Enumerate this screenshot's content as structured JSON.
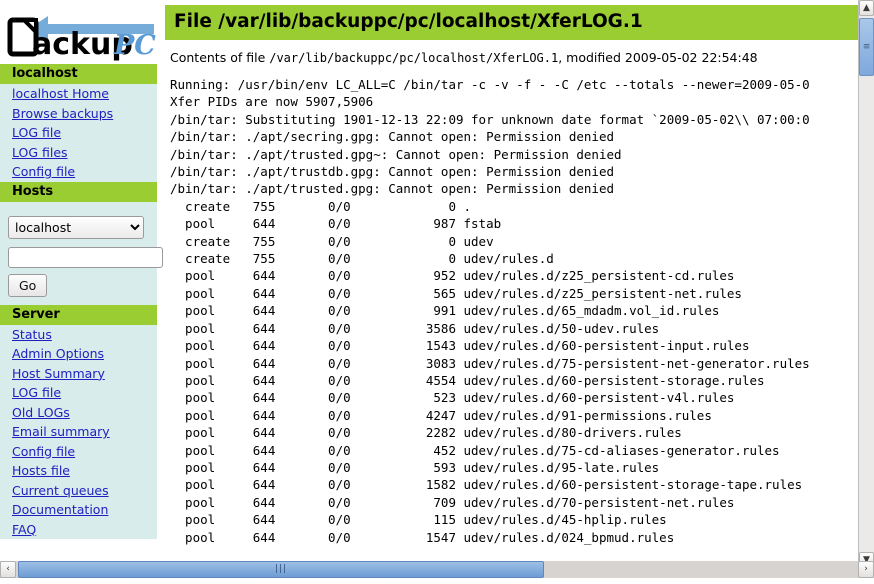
{
  "app": {
    "logo_primary": "ackup",
    "logo_secondary": "PC",
    "logo_icon": "document-arrow-logo"
  },
  "sidebar": {
    "host_section": {
      "heading": "localhost",
      "links": [
        {
          "label": "localhost Home",
          "name": "sidebar-link-localhost-home"
        },
        {
          "label": "Browse backups",
          "name": "sidebar-link-browse-backups"
        },
        {
          "label": "LOG file",
          "name": "sidebar-link-host-log-file"
        },
        {
          "label": "LOG files",
          "name": "sidebar-link-host-log-files"
        },
        {
          "label": "Config file",
          "name": "sidebar-link-host-config-file"
        }
      ]
    },
    "hosts_section": {
      "heading": "Hosts",
      "select_value": "localhost",
      "select_options": [
        "localhost"
      ],
      "search_value": "",
      "search_placeholder": "",
      "go_label": "Go"
    },
    "server_section": {
      "heading": "Server",
      "links": [
        {
          "label": "Status",
          "name": "sidebar-link-status"
        },
        {
          "label": "Admin Options",
          "name": "sidebar-link-admin-options"
        },
        {
          "label": "Host Summary",
          "name": "sidebar-link-host-summary"
        },
        {
          "label": "LOG file",
          "name": "sidebar-link-server-log-file"
        },
        {
          "label": "Old LOGs",
          "name": "sidebar-link-old-logs"
        },
        {
          "label": "Email summary",
          "name": "sidebar-link-email-summary"
        },
        {
          "label": "Config file",
          "name": "sidebar-link-server-config-file"
        },
        {
          "label": "Hosts file",
          "name": "sidebar-link-hosts-file"
        },
        {
          "label": "Current queues",
          "name": "sidebar-link-current-queues"
        },
        {
          "label": "Documentation",
          "name": "sidebar-link-documentation"
        },
        {
          "label": "FAQ",
          "name": "sidebar-link-faq"
        }
      ]
    }
  },
  "main": {
    "title": "File /var/lib/backuppc/pc/localhost/XferLOG.1",
    "subtitle_prefix": "Contents of file ",
    "subtitle_path": "/var/lib/backuppc/pc/localhost/XferLOG.1",
    "subtitle_suffix": ", modified 2009-05-02 22:54:48",
    "log_text": "Running: /usr/bin/env LC_ALL=C /bin/tar -c -v -f - -C /etc --totals --newer=2009-05-0\nXfer PIDs are now 5907,5906\n/bin/tar: Substituting 1901-12-13 22:09 for unknown date format `2009-05-02\\\\ 07:00:0\n/bin/tar: ./apt/secring.gpg: Cannot open: Permission denied\n/bin/tar: ./apt/trusted.gpg~: Cannot open: Permission denied\n/bin/tar: ./apt/trustdb.gpg: Cannot open: Permission denied\n/bin/tar: ./apt/trusted.gpg: Cannot open: Permission denied\n  create   755       0/0             0 .\n  pool     644       0/0           987 fstab\n  create   755       0/0             0 udev\n  create   755       0/0             0 udev/rules.d\n  pool     644       0/0           952 udev/rules.d/z25_persistent-cd.rules\n  pool     644       0/0           565 udev/rules.d/z25_persistent-net.rules\n  pool     644       0/0           991 udev/rules.d/65_mdadm.vol_id.rules\n  pool     644       0/0          3586 udev/rules.d/50-udev.rules\n  pool     644       0/0          1543 udev/rules.d/60-persistent-input.rules\n  pool     644       0/0          3083 udev/rules.d/75-persistent-net-generator.rules\n  pool     644       0/0          4554 udev/rules.d/60-persistent-storage.rules\n  pool     644       0/0           523 udev/rules.d/60-persistent-v4l.rules\n  pool     644       0/0          4247 udev/rules.d/91-permissions.rules\n  pool     644       0/0          2282 udev/rules.d/80-drivers.rules\n  pool     644       0/0           452 udev/rules.d/75-cd-aliases-generator.rules\n  pool     644       0/0           593 udev/rules.d/95-late.rules\n  pool     644       0/0          1582 udev/rules.d/60-persistent-storage-tape.rules\n  pool     644       0/0           709 udev/rules.d/70-persistent-net.rules\n  pool     644       0/0           115 udev/rules.d/45-hplip.rules\n  pool     644       0/0          1547 udev/rules.d/024_bpmud.rules"
  },
  "scrollbars": {
    "vertical_up_glyph": "▲",
    "vertical_down_glyph": "▼",
    "vertical_grip": "≡",
    "horizontal_left_glyph": "‹",
    "horizontal_right_glyph": "›",
    "horizontal_grip": "|||"
  }
}
